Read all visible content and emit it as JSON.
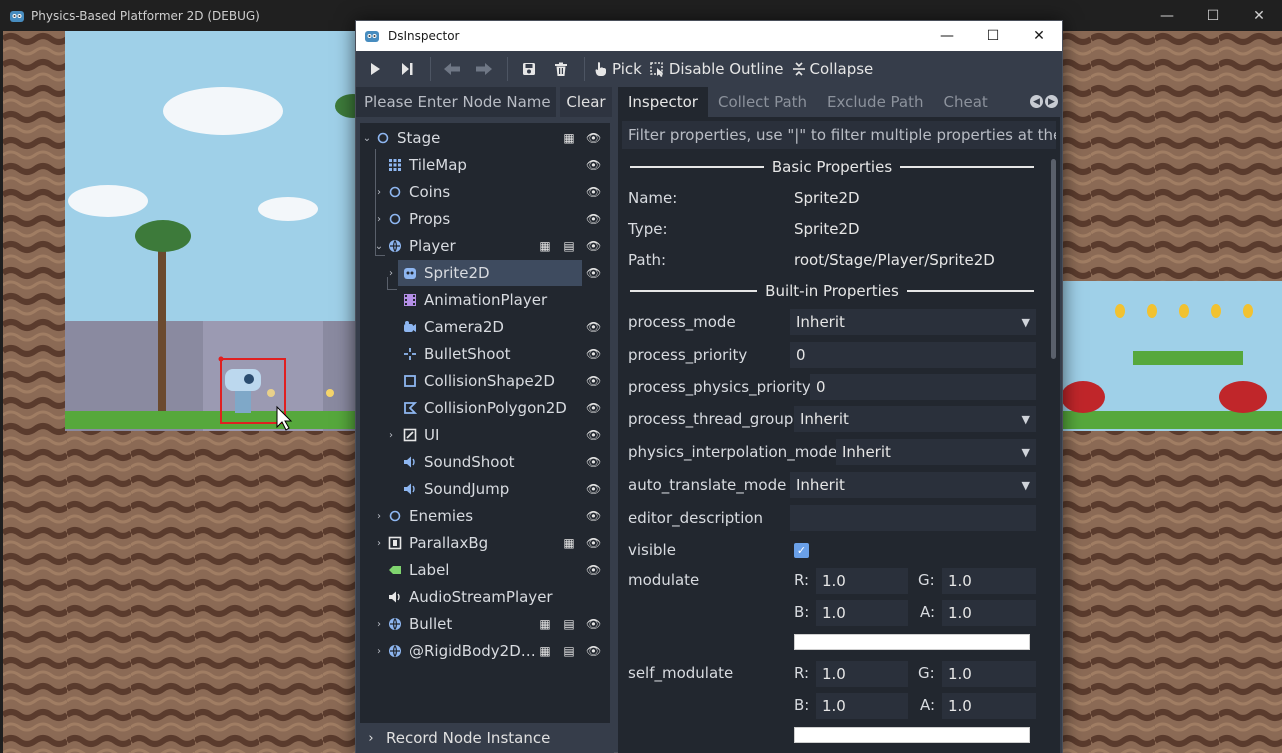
{
  "game": {
    "title": "Physics-Based Platformer 2D (DEBUG)"
  },
  "window_controls": {
    "minimize": "—",
    "maximize": "☐",
    "close": "✕"
  },
  "inspector_window": {
    "title": "DsInspector"
  },
  "toolbar": {
    "pick_label": "Pick",
    "disable_outline_label": "Disable Outline",
    "collapse_label": "Collapse"
  },
  "tree_panel": {
    "search_placeholder": "Please Enter Node Name",
    "clear_label": "Clear",
    "nodes": [
      {
        "label": "Stage"
      },
      {
        "label": "TileMap"
      },
      {
        "label": "Coins"
      },
      {
        "label": "Props"
      },
      {
        "label": "Player"
      },
      {
        "label": "Sprite2D"
      },
      {
        "label": "AnimationPlayer"
      },
      {
        "label": "Camera2D"
      },
      {
        "label": "BulletShoot"
      },
      {
        "label": "CollisionShape2D"
      },
      {
        "label": "CollisionPolygon2D"
      },
      {
        "label": "UI"
      },
      {
        "label": "SoundShoot"
      },
      {
        "label": "SoundJump"
      },
      {
        "label": "Enemies"
      },
      {
        "label": "ParallaxBg"
      },
      {
        "label": "Label"
      },
      {
        "label": "AudioStreamPlayer"
      },
      {
        "label": "Bullet"
      },
      {
        "label": "@RigidBody2D…"
      }
    ],
    "record_label": "Record Node Instance"
  },
  "tabs": [
    {
      "label": "Inspector"
    },
    {
      "label": "Collect Path"
    },
    {
      "label": "Exclude Path"
    },
    {
      "label": "Cheat"
    }
  ],
  "inspector": {
    "filter_placeholder": "Filter properties, use \"|\" to filter multiple properties at the",
    "basic_title": "Basic Properties",
    "builtin_title": "Built-in Properties",
    "name_label": "Name:",
    "name_value": "Sprite2D",
    "type_label": "Type:",
    "type_value": "Sprite2D",
    "path_label": "Path:",
    "path_value": "root/Stage/Player/Sprite2D",
    "props": {
      "process_mode": {
        "label": "process_mode",
        "value": "Inherit"
      },
      "process_priority": {
        "label": "process_priority",
        "value": "0"
      },
      "process_physics_priority": {
        "label": "process_physics_priority",
        "value": "0"
      },
      "process_thread_group": {
        "label": "process_thread_group",
        "value": "Inherit"
      },
      "physics_interpolation_mode": {
        "label": "physics_interpolation_mode",
        "value": "Inherit"
      },
      "auto_translate_mode": {
        "label": "auto_translate_mode",
        "value": "Inherit"
      },
      "editor_description": {
        "label": "editor_description",
        "value": ""
      },
      "visible": {
        "label": "visible",
        "checked": true
      },
      "modulate": {
        "label": "modulate",
        "r": "1.0",
        "g": "1.0",
        "b": "1.0",
        "a": "1.0"
      },
      "self_modulate": {
        "label": "self_modulate",
        "r": "1.0",
        "g": "1.0",
        "b": "1.0",
        "a": "1.0"
      }
    },
    "channels": {
      "r": "R:",
      "g": "G:",
      "b": "B:",
      "a": "A:"
    }
  },
  "colors": {
    "panel_bg": "#363d4a",
    "tree_bg": "#22272f",
    "selected_bg": "#3e4b5f",
    "accent": "#6aa0e8"
  }
}
